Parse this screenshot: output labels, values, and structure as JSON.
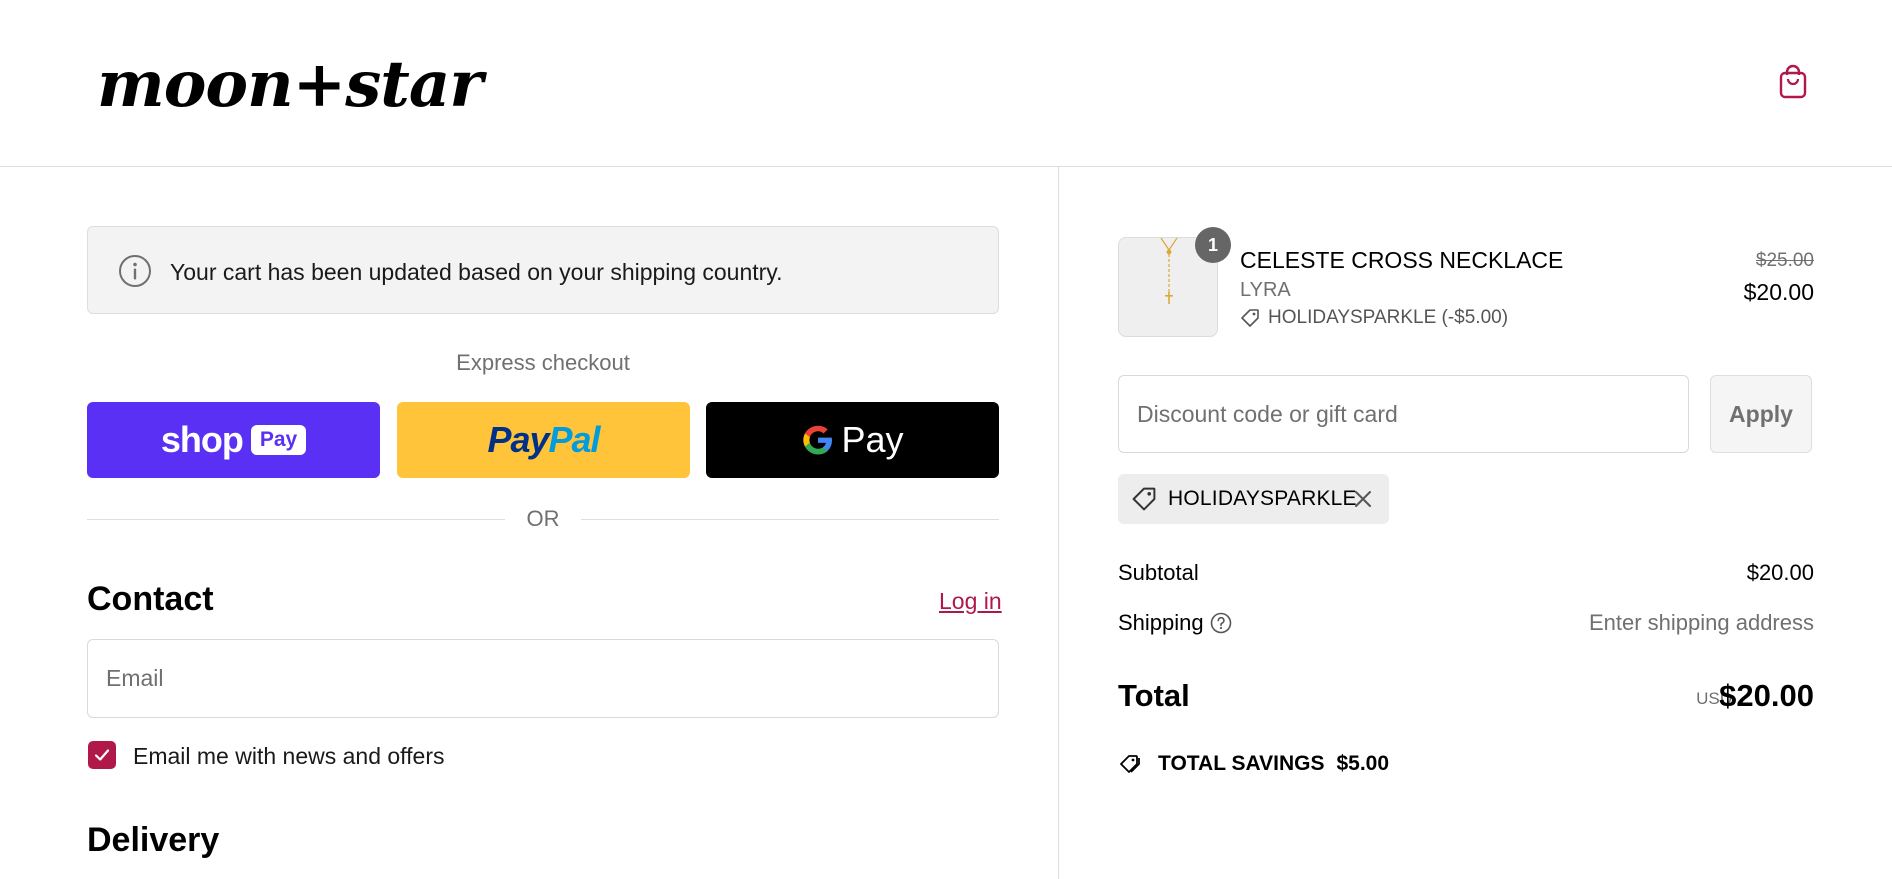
{
  "header": {
    "logo_text": "moon+star",
    "cart_icon": "shopping-bag-icon",
    "accent_color": "#b1184a"
  },
  "banner": {
    "icon": "info-icon",
    "text": "Your cart has been updated based on your shipping country."
  },
  "express": {
    "label": "Express checkout",
    "shop_pay": {
      "shop": "shop",
      "pay": "Pay",
      "color": "#5a31f4"
    },
    "paypal": {
      "pay": "Pay",
      "pal": "Pal",
      "color": "#ffc439"
    },
    "gpay": {
      "text": "Pay",
      "color": "#000000"
    }
  },
  "divider": {
    "or": "OR"
  },
  "contact": {
    "title": "Contact",
    "login": "Log in",
    "email_placeholder": "Email",
    "newsletter_label": "Email me with news and offers",
    "newsletter_checked": true
  },
  "delivery": {
    "title": "Delivery"
  },
  "order": {
    "item": {
      "quantity": "1",
      "name": "CELESTE CROSS NECKLACE",
      "variant": "LYRA",
      "discount": "HOLIDAYSPARKLE (-$5.00)",
      "price_original": "$25.00",
      "price_final": "$20.00"
    },
    "discount_placeholder": "Discount code or gift card",
    "apply_label": "Apply",
    "applied_code": "HOLIDAYSPARKLE",
    "subtotal_label": "Subtotal",
    "subtotal_value": "$20.00",
    "shipping_label": "Shipping",
    "shipping_value": "Enter shipping address",
    "total_label": "Total",
    "total_currency": "USD",
    "total_value": "$20.00",
    "savings_label": "TOTAL SAVINGS",
    "savings_value": "$5.00"
  }
}
